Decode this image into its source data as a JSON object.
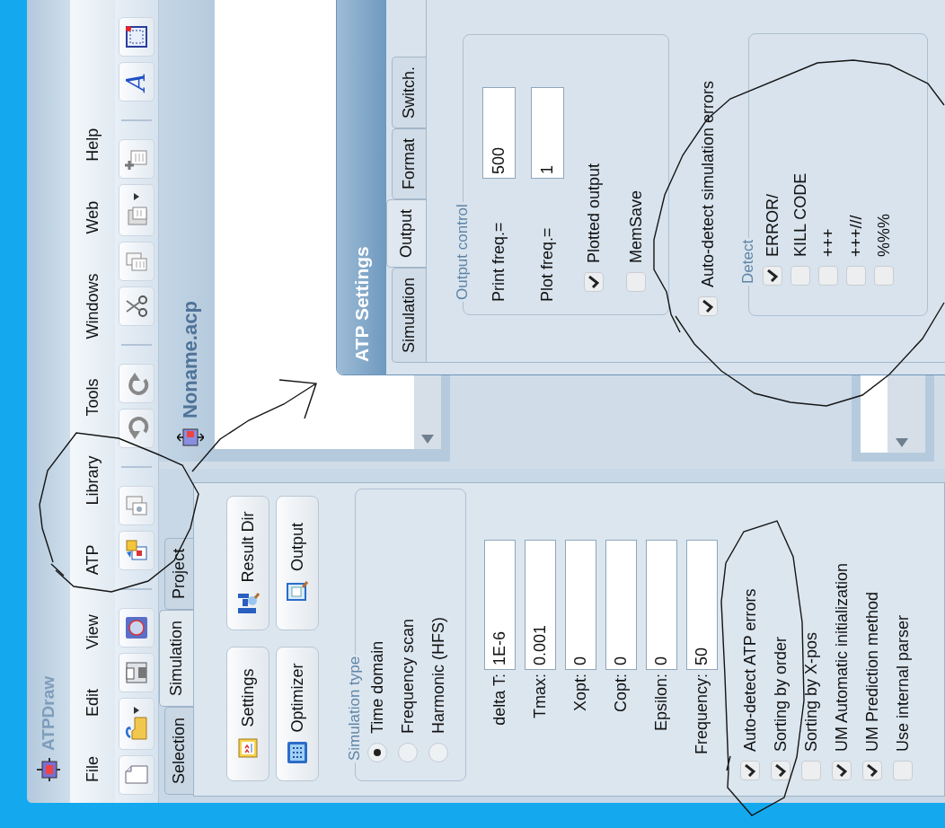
{
  "window": {
    "title": "ATPDraw"
  },
  "menu": [
    "File",
    "Edit",
    "View",
    "ATP",
    "Library",
    "Tools",
    "Windows",
    "Web",
    "Help"
  ],
  "toolbar": [
    {
      "kind": "new",
      "dropdown": false
    },
    {
      "kind": "open",
      "dropdown": true
    },
    {
      "kind": "save",
      "dropdown": false
    },
    {
      "kind": "view",
      "dropdown": false
    },
    {
      "kind": "separator"
    },
    {
      "kind": "run",
      "dropdown": false
    },
    {
      "kind": "edit",
      "dropdown": false
    },
    {
      "kind": "separator"
    },
    {
      "kind": "undo",
      "dropdown": false
    },
    {
      "kind": "redo",
      "dropdown": false
    },
    {
      "kind": "separator"
    },
    {
      "kind": "cut",
      "dropdown": false
    },
    {
      "kind": "copy",
      "dropdown": false
    },
    {
      "kind": "paste",
      "dropdown": true
    },
    {
      "kind": "duplicate",
      "dropdown": false
    },
    {
      "kind": "separator"
    },
    {
      "kind": "text",
      "glyph": "A",
      "dropdown": false
    },
    {
      "kind": "frame",
      "dropdown": false
    }
  ],
  "side_tabs": [
    {
      "label": "Selection",
      "selected": false
    },
    {
      "label": "Simulation",
      "selected": true
    },
    {
      "label": "Project",
      "selected": false
    }
  ],
  "side_buttons": [
    {
      "label": "Settings",
      "kind": "settings"
    },
    {
      "label": "Result Dir",
      "kind": "result"
    },
    {
      "label": "Optimizer",
      "kind": "optimizer"
    },
    {
      "label": "Output",
      "kind": "output"
    }
  ],
  "simulation_type": {
    "title": "Simulation type",
    "options": [
      {
        "label": "Time domain",
        "selected": true
      },
      {
        "label": "Frequency scan",
        "selected": false
      },
      {
        "label": "Harmonic (HFS)",
        "selected": false
      }
    ]
  },
  "fields": [
    {
      "label": "delta T:",
      "value": "1E-6"
    },
    {
      "label": "Tmax:",
      "value": "0.001"
    },
    {
      "label": "Xopt:",
      "value": "0"
    },
    {
      "label": "Copt:",
      "value": "0"
    },
    {
      "label": "Epsilon:",
      "value": "0"
    },
    {
      "label": "Frequency:",
      "value": "50"
    }
  ],
  "options": [
    {
      "label": "Auto-detect ATP errors",
      "checked": true
    },
    {
      "label": "Sorting by order",
      "checked": true
    },
    {
      "label": "Sorting by X-pos",
      "checked": false
    },
    {
      "label": "UM Automatic initialization",
      "checked": true
    },
    {
      "label": "UM Prediction method",
      "checked": true
    },
    {
      "label": "Use internal parser",
      "checked": false
    }
  ],
  "document": {
    "title": "Noname.acp"
  },
  "dialog": {
    "title": "ATP Settings",
    "tabs": [
      {
        "label": "Simulation",
        "selected": false
      },
      {
        "label": "Output",
        "selected": true
      },
      {
        "label": "Format",
        "selected": false
      },
      {
        "label": "Switch.",
        "selected": false
      }
    ],
    "output_control": {
      "title": "Output control",
      "fields": [
        {
          "label": "Print freq.=",
          "value": "500"
        },
        {
          "label": "Plot freq.=",
          "value": "1"
        }
      ],
      "options": [
        {
          "label": "Plotted output",
          "checked": true
        },
        {
          "label": "MemSave",
          "checked": false
        }
      ]
    },
    "auto_detect": {
      "label": "Auto-detect simulation errors",
      "checked": true
    },
    "detect": {
      "title": "Detect",
      "options": [
        {
          "label": "ERROR/",
          "checked": true
        },
        {
          "label": "KILL CODE",
          "checked": false
        },
        {
          "label": "+++",
          "checked": false
        },
        {
          "label": "+++///",
          "checked": false
        },
        {
          "label": "%%%",
          "checked": false
        }
      ]
    }
  },
  "annotations": [
    {
      "kind": "circle"
    },
    {
      "kind": "arrow"
    },
    {
      "kind": "circle"
    },
    {
      "kind": "circle"
    }
  ]
}
